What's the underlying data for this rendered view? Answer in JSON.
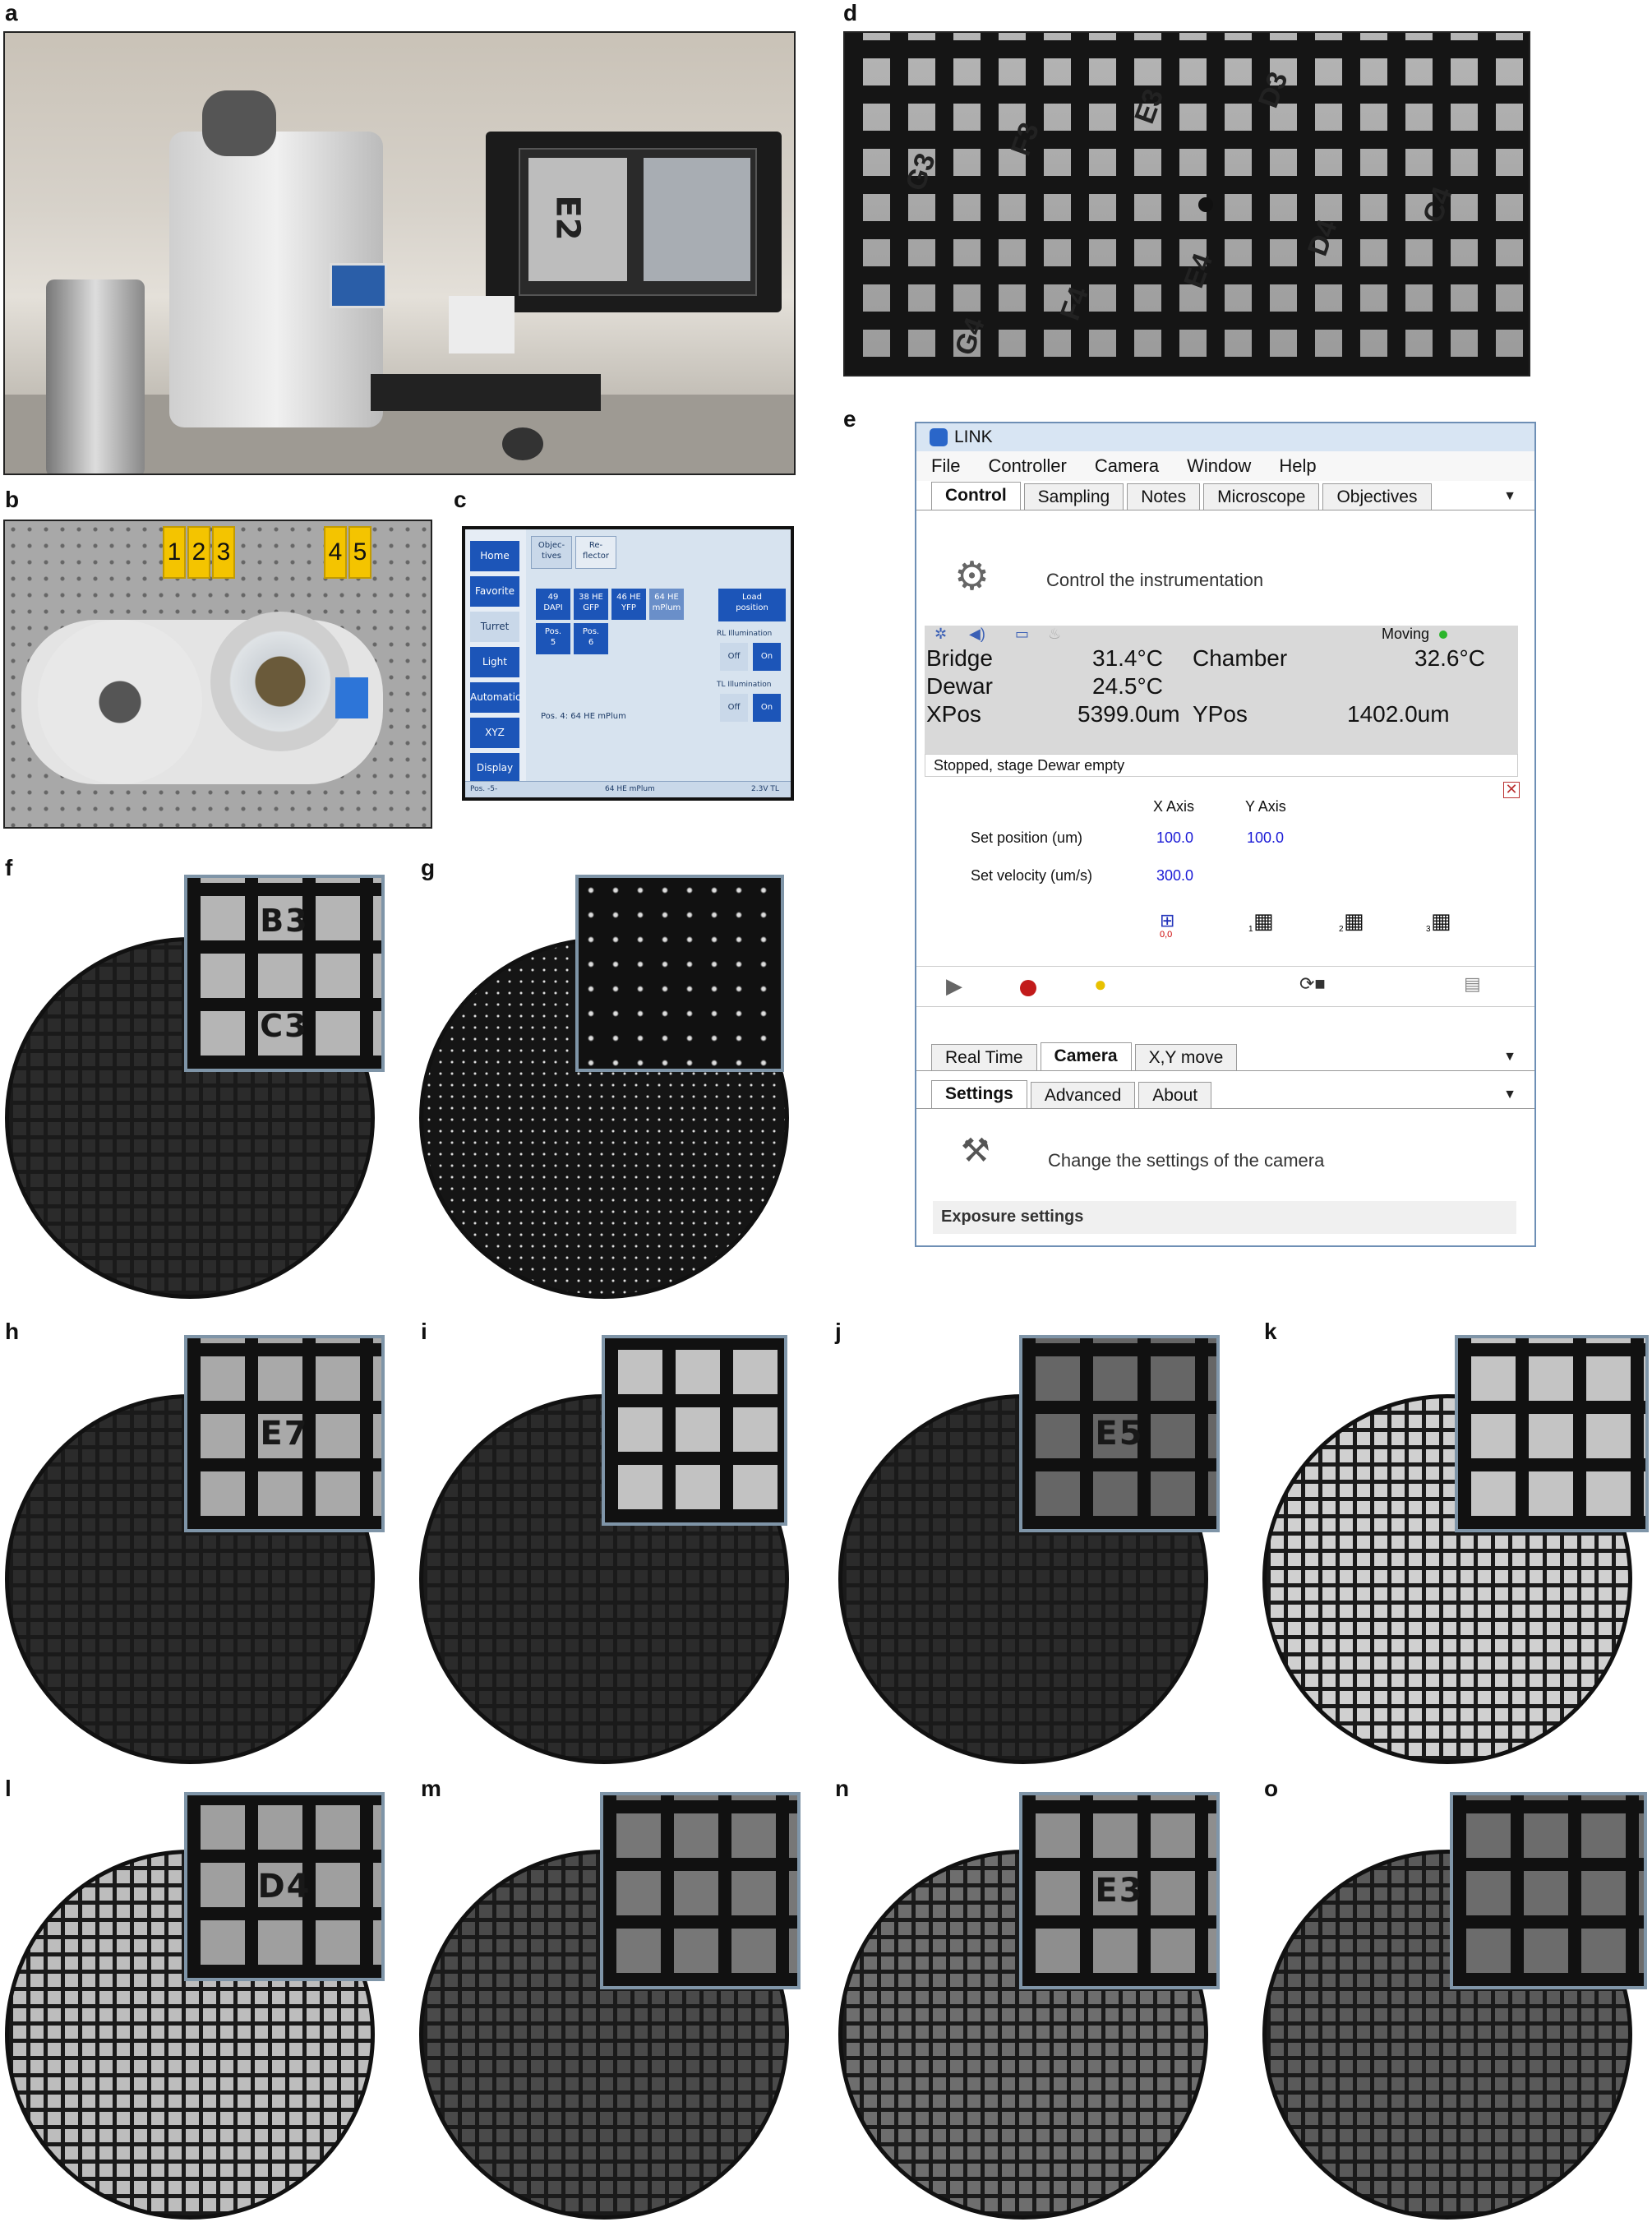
{
  "panel_labels": {
    "a": "a",
    "b": "b",
    "c": "c",
    "d": "d",
    "e": "e",
    "f": "f",
    "g": "g",
    "h": "h",
    "i": "i",
    "j": "j",
    "k": "k",
    "l": "l",
    "m": "m",
    "n": "n",
    "o": "o"
  },
  "cable_tags": [
    "1",
    "2",
    "3",
    "4",
    "5"
  ],
  "panel_c": {
    "side_buttons": [
      "Home",
      "Favorite",
      "Turret",
      "Light",
      "Automatic",
      "XYZ",
      "Display"
    ],
    "tabs": [
      "Objec-\ntives",
      "Re-\nflector"
    ],
    "objectives": [
      "49\nDAPI",
      "38 HE\nGFP",
      "46 HE\nYFP",
      "64 HE\nmPlum"
    ],
    "positions": [
      "Pos.\n5",
      "Pos.\n6"
    ],
    "load_position": "Load\nposition",
    "rl_label": "RL Illumination",
    "tl_label": "TL Illumination",
    "off": "Off",
    "on": "On",
    "pos_text": "Pos. 4: 64 HE mPlum",
    "status_left": "Pos. -5-",
    "status_mid": "64 HE mPlum",
    "status_right": "2.3V TL"
  },
  "monitor_label": "E2",
  "panel_d_labels": [
    "D3",
    "E3",
    "F3",
    "G3",
    "C4",
    "D4",
    "E4",
    "F4",
    "G4"
  ],
  "link_app": {
    "title": "LINK",
    "menu": [
      "File",
      "Controller",
      "Camera",
      "Window",
      "Help"
    ],
    "tabs": [
      "Control",
      "Sampling",
      "Notes",
      "Microscope",
      "Objectives"
    ],
    "control_caption": "Control the instrumentation",
    "status_moving": "Moving",
    "readings": {
      "bridge_label": "Bridge",
      "bridge_value": "31.4°C",
      "chamber_label": "Chamber",
      "chamber_value": "32.6°C",
      "dewar_label": "Dewar",
      "dewar_value": "24.5°C",
      "xpos_label": "XPos",
      "xpos_value": "5399.0um",
      "ypos_label": "YPos",
      "ypos_value": "1402.0um"
    },
    "status_line": "Stopped, stage Dewar empty",
    "axis_headers": [
      "X Axis",
      "Y Axis"
    ],
    "set_position_label": "Set position (um)",
    "set_position_x": "100.0",
    "set_position_y": "100.0",
    "set_velocity_label": "Set velocity (um/s)",
    "set_velocity_x": "300.0",
    "grid_icon_labels": [
      "0,0",
      "1",
      "2",
      "3"
    ],
    "camera_tabs": [
      "Real Time",
      "Camera",
      "X,Y move"
    ],
    "settings_tabs": [
      "Settings",
      "Advanced",
      "About"
    ],
    "settings_caption": "Change the settings of the camera",
    "exposure_header": "Exposure settings"
  },
  "grid_insets": {
    "f": "B3\nC3",
    "h": "E7",
    "j": "E5",
    "l": "D4",
    "n": "E3"
  }
}
